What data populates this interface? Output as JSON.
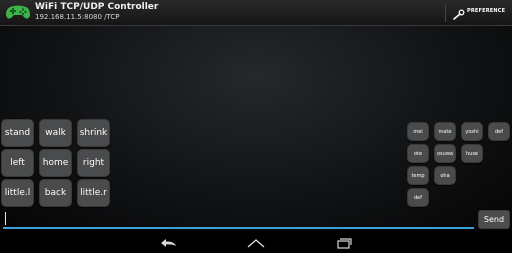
{
  "action_bar": {
    "title": "WiFi TCP/UDP Controller",
    "subtitle": "192.168.11.5:8080 /TCP",
    "logo_icon": "gamepad-icon",
    "preference_label": "PREFERENCE",
    "preference_icon": "wrench-icon"
  },
  "main_buttons": [
    {
      "label": "stand"
    },
    {
      "label": "walk"
    },
    {
      "label": "shrink"
    },
    {
      "label": "left"
    },
    {
      "label": "home"
    },
    {
      "label": "right"
    },
    {
      "label": "little.l"
    },
    {
      "label": "back"
    },
    {
      "label": "little.r"
    }
  ],
  "macro_buttons": [
    {
      "label": "mei"
    },
    {
      "label": "mate"
    },
    {
      "label": "yoshi"
    },
    {
      "label": "def"
    },
    {
      "label": "ote"
    },
    {
      "label": "osuwa"
    },
    {
      "label": "huse"
    },
    {
      "label": "temp"
    },
    {
      "label": "oha"
    },
    {
      "label": "def"
    }
  ],
  "input": {
    "value": ""
  },
  "send_label": "Send",
  "nav": {
    "back_icon": "back-icon",
    "home_icon": "home-icon",
    "recents_icon": "recents-icon"
  },
  "colors": {
    "accent": "#3aa0d8",
    "logo": "#3bb34a",
    "button": "#4a4b4c"
  }
}
